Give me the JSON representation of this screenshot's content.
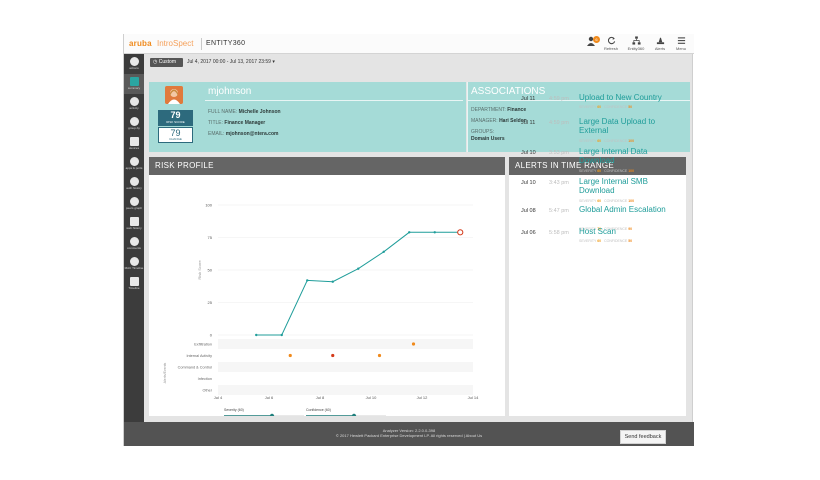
{
  "header": {
    "brand": "aruba",
    "product": "IntroSpect",
    "page_title": "ENTITY360",
    "notification_count": "6",
    "buttons": [
      {
        "label": "Refresh",
        "icon": "refresh-icon"
      },
      {
        "label": "Entity360",
        "icon": "org-chart-icon"
      },
      {
        "label": "Alerts",
        "icon": "alerts-icon"
      },
      {
        "label": "Menu",
        "icon": "menu-icon"
      }
    ]
  },
  "sidebar": {
    "items": [
      {
        "label": "actions",
        "icon": "actions-icon"
      },
      {
        "label": "summary",
        "icon": "summary-icon",
        "active": true
      },
      {
        "label": "activity",
        "icon": "activity-icon"
      },
      {
        "label": "group-by",
        "icon": "group-by-icon"
      },
      {
        "label": "devices",
        "icon": "devices-icon"
      },
      {
        "label": "apps & ports",
        "icon": "apps-icon"
      },
      {
        "label": "auth history",
        "icon": "auth-icon"
      },
      {
        "label": "peers graph",
        "icon": "peers-icon"
      },
      {
        "label": "web history",
        "icon": "web-icon"
      },
      {
        "label": "comments",
        "icon": "comments-icon"
      },
      {
        "label": "MAC Timeline",
        "icon": "mac-icon"
      },
      {
        "label": "Timeline",
        "icon": "timeline-icon"
      }
    ]
  },
  "filter": {
    "custom_label": "Custom",
    "date_range": "Jul 4, 2017 00:00 - Jul 13, 2017 23:59"
  },
  "profile": {
    "username": "mjohnson",
    "full_name_label": "FULL NAME:",
    "full_name": "Michelle Johnson",
    "title_label": "TITLE:",
    "title": "Finance Manager",
    "email_label": "EMAIL:",
    "email": "mjohnson@ntera.com",
    "risk_score": "79",
    "risk_score_label": "RISK SCORE",
    "change": "79",
    "change_label": "CHANGE"
  },
  "associations": {
    "title": "ASSOCIATIONS",
    "department_label": "DEPARTMENT:",
    "department": "Finance",
    "manager_label": "MANAGER:",
    "manager": "Hari Seldon",
    "groups_label": "GROUPS:",
    "groups": "Domain Users"
  },
  "risk_profile": {
    "title": "RISK PROFILE",
    "severity_label": "Severity (60)",
    "confidence_label": "Confidence (60)",
    "severity_value": 60,
    "confidence_value": 60
  },
  "chart_data": {
    "type": "line",
    "ylabel": "Risk Score",
    "event_axis_label": "Alerts/Events",
    "ylim": [
      0,
      100
    ],
    "yticks": [
      "0",
      "25",
      "50",
      "75",
      "100"
    ],
    "xlim": [
      "Jul 4",
      "Jul 14"
    ],
    "xticks": [
      "Jul 4",
      "Jul 6",
      "Jul 8",
      "Jul 10",
      "Jul 12",
      "Jul 14"
    ],
    "series": [
      {
        "x": [
          "Jul 5 12:00",
          "Jul 6 12:00",
          "Jul 7 12:00",
          "Jul 8 12:00",
          "Jul 9 12:00",
          "Jul 10 12:00",
          "Jul 11 12:00",
          "Jul 12 12:00",
          "Jul 13 12:00"
        ],
        "values": [
          0,
          0,
          42,
          41,
          51,
          64,
          79,
          79,
          79
        ]
      }
    ],
    "event_categories": [
      "Exfiltration",
      "Internal Activity",
      "Command & Control",
      "Infection",
      "Other"
    ],
    "events": [
      {
        "x": "Jul 11 16:00",
        "category": "Exfiltration",
        "color": "#f08a1c"
      },
      {
        "x": "Jul 6 20:00",
        "category": "Internal Activity",
        "color": "#f08a1c"
      },
      {
        "x": "Jul 8 12:00",
        "category": "Internal Activity",
        "color": "#d43a1a"
      },
      {
        "x": "Jul 10 08:00",
        "category": "Internal Activity",
        "color": "#f08a1c"
      }
    ],
    "line_color": "#1f9d9a",
    "last_point_color": "#d43a1a"
  },
  "alerts": {
    "title": "ALERTS IN TIME RANGE",
    "severity_label": "SEVERITY",
    "confidence_label": "CONFIDENCE",
    "items": [
      {
        "date": "Jul 11",
        "time": "4:59 pm",
        "title": "Upload to New Country",
        "severity": "60",
        "confidence": "50"
      },
      {
        "date": "Jul 11",
        "time": "4:59 pm",
        "title": "Large Data Upload to External",
        "severity": "60",
        "confidence": "100"
      },
      {
        "date": "Jul 10",
        "time": "3:53 pm",
        "title": "Large Internal Data Download",
        "severity": "60",
        "confidence": "100"
      },
      {
        "date": "Jul 10",
        "time": "3:43 pm",
        "title": "Large Internal SMB Download",
        "severity": "60",
        "confidence": "100"
      },
      {
        "date": "Jul 08",
        "time": "5:47 pm",
        "title": "Global Admin Escalation",
        "severity": "70",
        "confidence": "90"
      },
      {
        "date": "Jul 06",
        "time": "5:58 pm",
        "title": "Host Scan",
        "severity": "60",
        "confidence": "50"
      }
    ]
  },
  "footer": {
    "version": "Analyzer Version: 2.2.0.0-398",
    "copyright": "© 2017 Hewlett Packard Enterprise Development LP. All rights reserved | About Us",
    "feedback": "Send feedback"
  }
}
